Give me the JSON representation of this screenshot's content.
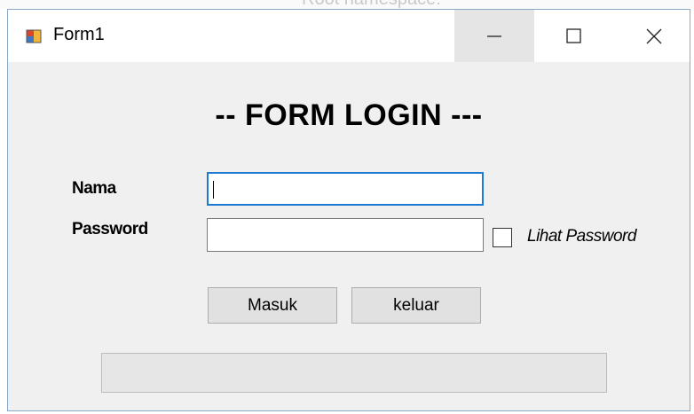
{
  "background": {
    "partial_text": "Root namespace:"
  },
  "window": {
    "title": "Form1",
    "icon": "winforms-app-icon",
    "controls": {
      "minimize_icon": "minimize-icon",
      "maximize_icon": "maximize-icon",
      "close_icon": "close-icon"
    }
  },
  "form": {
    "heading": "-- FORM LOGIN ---",
    "nama_label": "Nama",
    "nama_value": "",
    "password_label": "Password",
    "password_value": "",
    "show_password_label": "Lihat Password",
    "show_password_checked": false,
    "masuk_button": "Masuk",
    "keluar_button": "keluar",
    "progress_percent": 0
  },
  "colors": {
    "focus_border": "#1e7bd3",
    "window_bg": "#f0f0f0",
    "button_bg": "#e1e1e1"
  }
}
